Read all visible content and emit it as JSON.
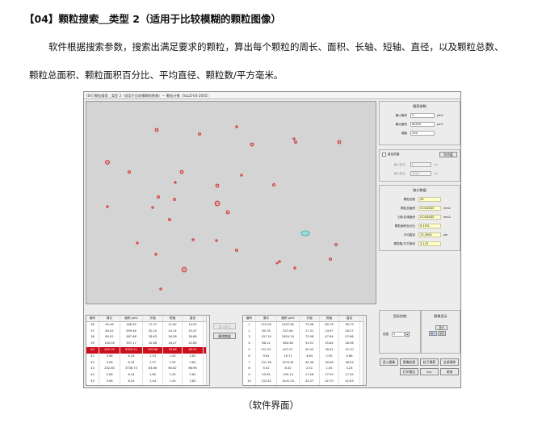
{
  "heading": "【04】颗粒搜索＿类型 2（适用于比较模糊的颗粒图像）",
  "paragraph_line1": "软件根据搜索参数，搜索出满足要求的颗粒，算出每个颗粒的周长、面积、长轴、短轴、直径，以及颗粒总数、",
  "paragraph_line2": "颗粒总面积、颗粒面积百分比、平均直径、颗粒数/平方毫米。",
  "caption": "（软件界面）",
  "app": {
    "window_title": "[04] 颗粒搜索＿类型 2（适用于比较模糊的图像）— 颗粒计数（SLLD-04-2005）",
    "search_params": {
      "title": "搜索参数",
      "min_area_label": "最小面积",
      "min_area_value": "0",
      "min_area_unit": "μm2",
      "max_area_label": "最大面积",
      "max_area_value": "60000",
      "max_area_unit": "μm2",
      "threshold_label": "阈值",
      "threshold_value": "200"
    },
    "diameter_range": {
      "checkbox_label": "直径范围",
      "button": "符合值",
      "min_label": "最小直径",
      "min_value": "0",
      "min_unit": "μm",
      "max_label": "最大直径",
      "max_value": "1000",
      "max_unit": "μm"
    },
    "stats": {
      "title": "统计数据",
      "items": [
        {
          "label": "颗粒总数",
          "value": "59",
          "unit": ""
        },
        {
          "label": "颗粒总面积",
          "value": "0.044483",
          "unit": "mm2"
        },
        {
          "label": "分析区域面积",
          "value": "0.044483",
          "unit": "mm2"
        },
        {
          "label": "颗粒面积百分比",
          "value": "0.10%",
          "unit": ""
        },
        {
          "label": "平均直径",
          "value": "23.5562",
          "unit": "μm"
        },
        {
          "label": "颗粒数/平方毫米",
          "value": "3.110",
          "unit": ""
        }
      ]
    },
    "mid_buttons": {
      "add_tag": "加入标注",
      "delete_data": "删除数据"
    },
    "table_headers": [
      "编号",
      "周长",
      "面积 μm2",
      "长轴",
      "短轴",
      "直径"
    ],
    "left_table": [
      [
        "36",
        "45.46",
        "166.35",
        "17.37",
        "11.62",
        "14.55"
      ],
      [
        "37",
        "84.02",
        "599.46",
        "30.10",
        "24.14",
        "25.47"
      ],
      [
        "38",
        "85.92",
        "587.66",
        "26.63",
        "26.38",
        "26.86"
      ],
      [
        "39",
        "100.05",
        "397.17",
        "32.66",
        "16.27",
        "22.64"
      ],
      [
        "40",
        "402.05",
        "6305.11",
        "139.66",
        "76.66",
        "46.53"
      ],
      [
        "41",
        "3.06",
        "6.24",
        "1.43",
        "1.43",
        "2.82"
      ],
      [
        "42",
        "3.06",
        "6.24",
        "2.97",
        "1.59",
        "2.82"
      ],
      [
        "43",
        "252.60",
        "3736.73",
        "83.66",
        "60.62",
        "66.96"
      ],
      [
        "44",
        "3.06",
        "6.24",
        "1.85",
        "1.43",
        "2.82"
      ],
      [
        "45",
        "3.06",
        "6.24",
        "1.44",
        "1.43",
        "2.82"
      ]
    ],
    "left_selected_row": 4,
    "right_table": [
      [
        "1",
        "225.99",
        "2497.60",
        "73.96",
        "60.76",
        "56.73"
      ],
      [
        "2",
        "60.76",
        "207.64",
        "17.31",
        "14.97",
        "16.27"
      ],
      [
        "3",
        "197.10",
        "2624.24",
        "72.98",
        "47.64",
        "57.66"
      ],
      [
        "4",
        "86.12",
        "640.46",
        "31.51",
        "25.64",
        "28.56"
      ],
      [
        "5",
        "151.31",
        "407.57",
        "32.03",
        "16.92",
        "22.70"
      ],
      [
        "6",
        "9.61",
        "19.71",
        "3.84",
        "2.90",
        "4.88"
      ],
      [
        "7",
        "131.36",
        "1070.61",
        "43.36",
        "30.96",
        "36.93"
      ],
      [
        "8",
        "5.52",
        "8.32",
        "2.51",
        "1.45",
        "3.25"
      ],
      [
        "9",
        "53.39",
        "239.13",
        "17.46",
        "17.09",
        "17.45"
      ],
      [
        "10",
        "132.42",
        "1441.24",
        "43.37",
        "42.70",
        "42.63"
      ]
    ],
    "target_control": {
      "title": "目标控制",
      "line_width_label": "线宽",
      "line_width_value": "5"
    },
    "image_display": {
      "title": "图像显示",
      "zoom_in": "放大",
      "zoom_out": "缩小",
      "fit": "适应"
    },
    "action_buttons": [
      "读入图像",
      "图像处理",
      "粒子搜索",
      "全部清除",
      "打印报告",
      "Esc",
      "结束"
    ]
  }
}
